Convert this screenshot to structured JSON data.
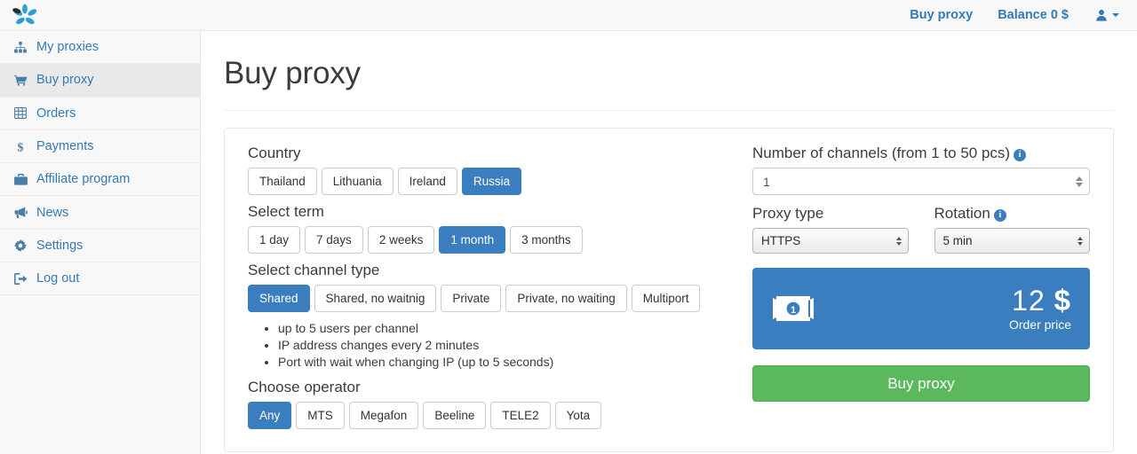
{
  "topbar": {
    "logo_name": "flower-logo",
    "nav": [
      {
        "label": "Buy proxy",
        "name": "topnav-buy-proxy"
      },
      {
        "label": "Balance 0 $",
        "name": "topnav-balance"
      }
    ],
    "user_icon": "user-icon"
  },
  "sidebar": {
    "items": [
      {
        "label": "My proxies",
        "icon": "sitemap-icon",
        "active": false
      },
      {
        "label": "Buy proxy",
        "icon": "cart-icon",
        "active": true
      },
      {
        "label": "Orders",
        "icon": "table-icon",
        "active": false
      },
      {
        "label": "Payments",
        "icon": "dollar-icon",
        "active": false
      },
      {
        "label": "Affiliate program",
        "icon": "briefcase-icon",
        "active": false
      },
      {
        "label": "News",
        "icon": "bullhorn-icon",
        "active": false
      },
      {
        "label": "Settings",
        "icon": "gear-icon",
        "active": false
      },
      {
        "label": "Log out",
        "icon": "sign-out-icon",
        "active": false
      }
    ]
  },
  "page": {
    "title": "Buy proxy"
  },
  "form": {
    "country": {
      "label": "Country",
      "options": [
        "Thailand",
        "Lithuania",
        "Ireland",
        "Russia"
      ],
      "selected": "Russia"
    },
    "term": {
      "label": "Select term",
      "options": [
        "1 day",
        "7 days",
        "2 weeks",
        "1 month",
        "3 months"
      ],
      "selected": "1 month"
    },
    "channel_type": {
      "label": "Select channel type",
      "options": [
        "Shared",
        "Shared, no waitnig",
        "Private",
        "Private, no waiting",
        "Multiport"
      ],
      "selected": "Shared",
      "features": [
        "up to 5 users per channel",
        "IP address changes every 2 minutes",
        "Port with wait when changing IP (up to 5 seconds)"
      ]
    },
    "operator": {
      "label": "Choose operator",
      "options": [
        "Any",
        "MTS",
        "Megafon",
        "Beeline",
        "TELE2",
        "Yota"
      ],
      "selected": "Any"
    },
    "channels": {
      "label": "Number of channels (from 1 to 50 pcs)",
      "info_icon": "info-icon",
      "value": "1"
    },
    "proxy_type": {
      "label": "Proxy type",
      "value": "HTTPS"
    },
    "rotation": {
      "label": "Rotation",
      "info_icon": "info-icon",
      "value": "5 min"
    },
    "price": {
      "icon": "banknote-icon",
      "amount": "12",
      "currency": "$",
      "caption": "Order price"
    },
    "submit": {
      "label": "Buy proxy"
    }
  },
  "colors": {
    "primary": "#3b7ebf",
    "link": "#337ab7",
    "success": "#5cb85c",
    "sidebar_bg": "#f8f8f8"
  }
}
